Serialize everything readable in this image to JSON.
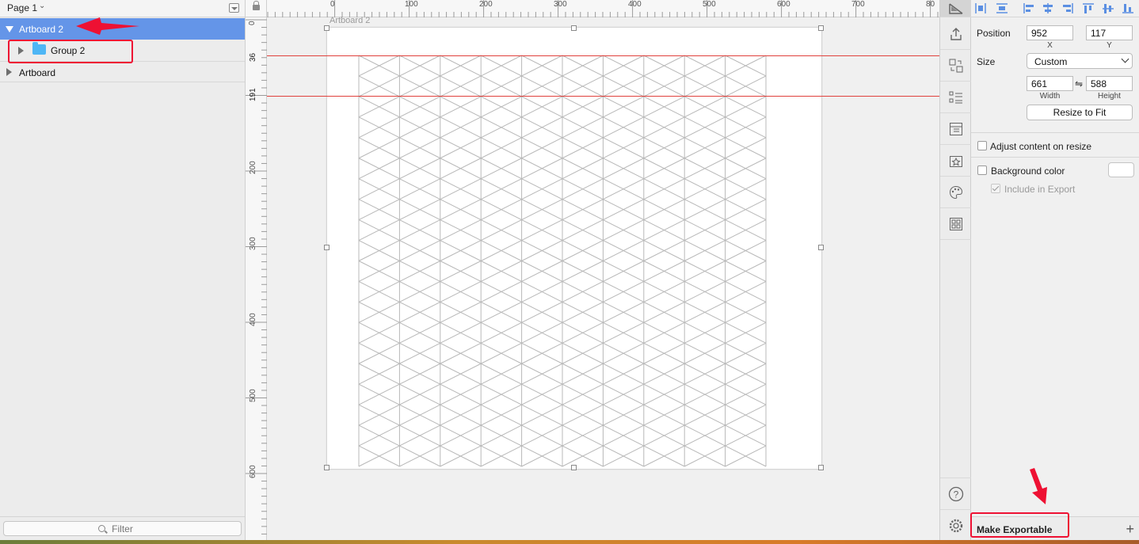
{
  "layers_panel": {
    "page_selector": "Page 1",
    "rows": [
      {
        "label": "Artboard 2",
        "selected": true,
        "expanded": true
      },
      {
        "label": "Group 2",
        "selected": false,
        "expanded": false
      },
      {
        "label": "Artboard",
        "selected": false,
        "expanded": false
      }
    ],
    "filter_placeholder": "Filter"
  },
  "canvas": {
    "artboard_title": "Artboard 2",
    "h_ruler_labels": [
      "0",
      "100",
      "200",
      "300",
      "400",
      "500",
      "600",
      "700",
      "80"
    ],
    "v_ruler_labels": [
      "0",
      "36",
      "191",
      "200",
      "300",
      "400",
      "500",
      "600"
    ],
    "guide_color": "#e0413c",
    "grid_line_color": "#b8b8b8"
  },
  "toolbar": {
    "icons": [
      "inspector-icon",
      "share-icon",
      "symbol-swap-icon",
      "layers-list-icon",
      "layout-icon",
      "symbols-icon",
      "color-palette-icon",
      "plugins-icon",
      "help-icon",
      "settings-icon"
    ]
  },
  "inspector": {
    "position_label": "Position",
    "position_x": "952",
    "position_y": "117",
    "x_caption": "X",
    "y_caption": "Y",
    "size_label": "Size",
    "size_preset": "Custom",
    "width": "661",
    "height": "588",
    "link_glyph": "⇋",
    "width_caption": "Width",
    "height_caption": "Height",
    "resize_button": "Resize to Fit",
    "adjust_content": "Adjust content on resize",
    "background_color": "Background color",
    "include_in_export": "Include in Export",
    "make_exportable": "Make Exportable",
    "add_glyph": "+"
  },
  "colors": {
    "selection": "#6495e8",
    "annotation": "#ee1133"
  }
}
